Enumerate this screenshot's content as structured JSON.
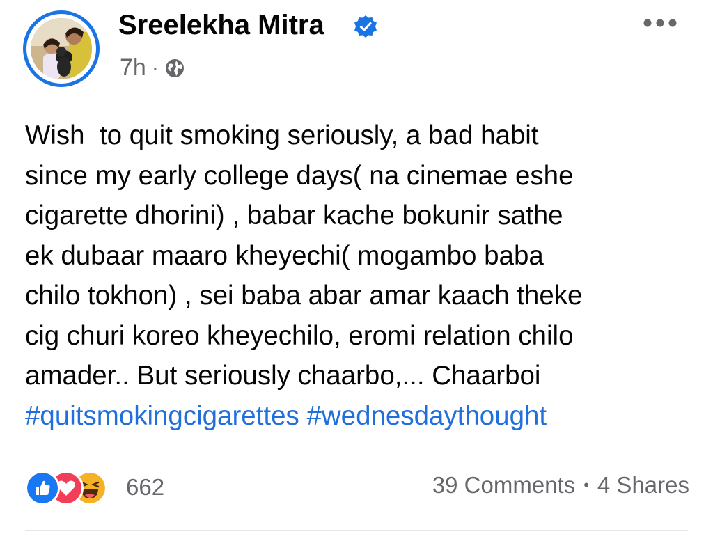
{
  "post": {
    "author": "Sreelekha Mitra",
    "time": "7h",
    "separator": "·",
    "audience_icon": "globe-icon",
    "more_icon": "more-options-icon",
    "text_lines": [
      "Wish  to quit smoking seriously, a bad habit",
      "since my early college days( na cinemae eshe",
      "cigarette dhorini) , babar kache bokunir sathe",
      "ek dubaar maaro kheyechi( mogambo baba",
      "chilo tokhon) , sei baba abar amar kaach theke",
      "cig churi koreo kheyechilo, eromi relation chilo",
      "amader.. But seriously chaarbo,... Chaarboi"
    ],
    "hashtags": [
      "#quitsmokingcigarettes",
      "#wednesdaythought"
    ]
  },
  "footer": {
    "reactions": [
      "like-icon",
      "love-icon",
      "haha-icon"
    ],
    "reaction_count": "662",
    "comments": "39 Comments",
    "dot": "•",
    "shares": "4 Shares"
  },
  "colors": {
    "accent": "#1b74e4",
    "hashtag": "#216fdb",
    "secondary_text": "#65676b",
    "love": "#f33e58",
    "haha": "#f7b125"
  }
}
